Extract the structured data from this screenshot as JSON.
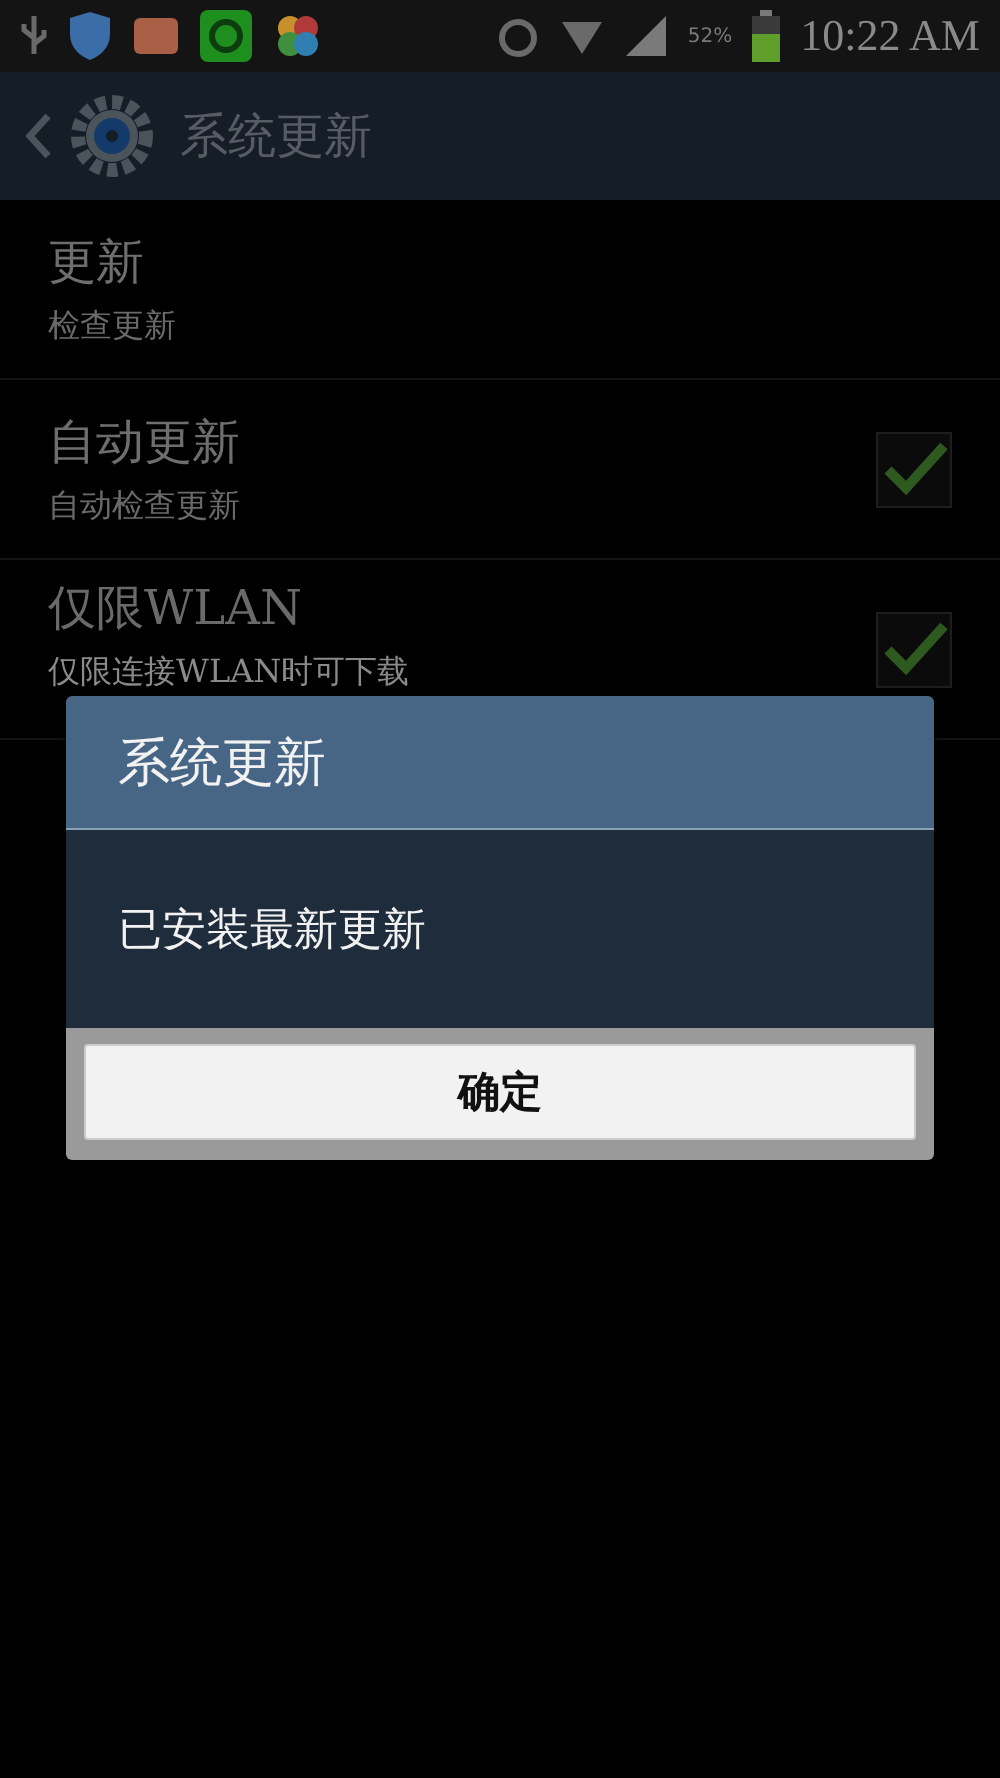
{
  "status_bar": {
    "battery": "52%",
    "time": "10:22 AM"
  },
  "header": {
    "title": "系统更新"
  },
  "settings": [
    {
      "title": "更新",
      "subtitle": "检查更新",
      "kind": "plain"
    },
    {
      "title": "自动更新",
      "subtitle": "自动检查更新",
      "kind": "checkbox",
      "checked": true
    },
    {
      "title": "仅限WLAN",
      "subtitle": "仅限连接WLAN时可下载",
      "kind": "checkbox",
      "checked": true
    }
  ],
  "dialog": {
    "title": "系统更新",
    "message": "已安装最新更新",
    "button": "确定"
  }
}
